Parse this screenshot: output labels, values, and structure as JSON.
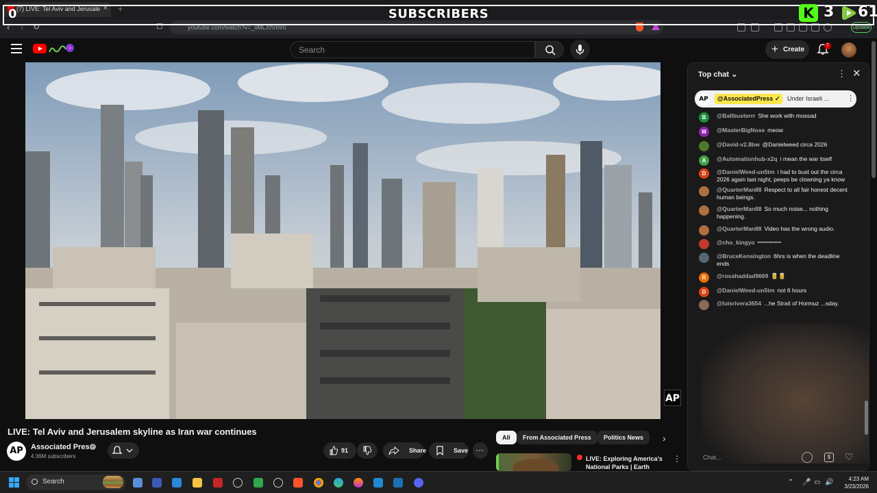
{
  "browser": {
    "tab_title": "(7) LIVE: Tel Aviv and Jerusale",
    "url": "youtube.com/watch?v=_iiMLXfVmr0",
    "update_label": "Update"
  },
  "overlay": {
    "title": "SUBSCRIBERS",
    "left_count": "0",
    "kick_count": "3",
    "rumble_count": "61"
  },
  "header": {
    "search_placeholder": "Search",
    "create_label": "Create",
    "notification_count": "7"
  },
  "video": {
    "title": "LIVE: Tel Aviv and Jerusalem skyline as Iran war continues",
    "watermark": "AP"
  },
  "channel": {
    "avatar_text": "AP",
    "name": "Associated Press",
    "subscribers": "4.36M subscribers"
  },
  "actions": {
    "likes": "91",
    "share": "Share",
    "save": "Save",
    "more": "···"
  },
  "chips": [
    "All",
    "From Associated Press",
    "Politics News"
  ],
  "recommendation": {
    "title": "LIVE: Exploring America's National Parks | Earth Month ..."
  },
  "chat": {
    "mode": "Top chat",
    "pinned": {
      "avatar": "AP",
      "author": "@AssociatedPress",
      "text": "Under Israeli ..."
    },
    "messages": [
      {
        "author": "@Ballbusterrr",
        "text": "She work with mossad",
        "initial": "B",
        "color": "#1e8e3e"
      },
      {
        "author": "@MasterBigNose",
        "text": "meow",
        "initial": "M",
        "color": "#8e24aa"
      },
      {
        "author": "@David-v2.8bw",
        "text": "@Danielweed circa 2026",
        "initial": "",
        "color": "#4a7a2a"
      },
      {
        "author": "@Automationhub-x2q",
        "text": "i mean the war itself",
        "initial": "A",
        "color": "#43a047"
      },
      {
        "author": "@DanielWeed-un5tm",
        "text": "i had to bust out the circa 2026 again last night, peeps be clowning ya know",
        "initial": "D",
        "color": "#d84315"
      },
      {
        "author": "@QuarterMan88",
        "text": "Respect to all fair honest decent human beings.",
        "initial": "",
        "color": "#b07040"
      },
      {
        "author": "@QuarterMan88",
        "text": "So much noise... nothing happening.",
        "initial": "",
        "color": "#b07040"
      },
      {
        "author": "@QuarterMan88",
        "text": "Video has the wrong audio.",
        "initial": "",
        "color": "#b07040"
      },
      {
        "author": "@cho_kingyo",
        "text": "ꟷꟷꟷꟷꟷ",
        "initial": "",
        "color": "#c0392b"
      },
      {
        "author": "@BruceKensington",
        "text": "6hrs is when the deadline ends",
        "initial": "",
        "color": "#556677"
      },
      {
        "author": "@rosahaddad9669",
        "text": "🥫🥫",
        "initial": "R",
        "color": "#ef6c00"
      },
      {
        "author": "@DanielWeed-un5tm",
        "text": "not 6 hours",
        "initial": "D",
        "color": "#d84315"
      },
      {
        "author": "@luisrivera3654",
        "text": "...he Strait of Hormuz ...sday.",
        "initial": "",
        "color": "#8a6a5a"
      }
    ],
    "input_placeholder": "Chat..."
  },
  "taskbar": {
    "search_label": "Search",
    "time": "4:23 AM",
    "date": "3/23/2026"
  }
}
